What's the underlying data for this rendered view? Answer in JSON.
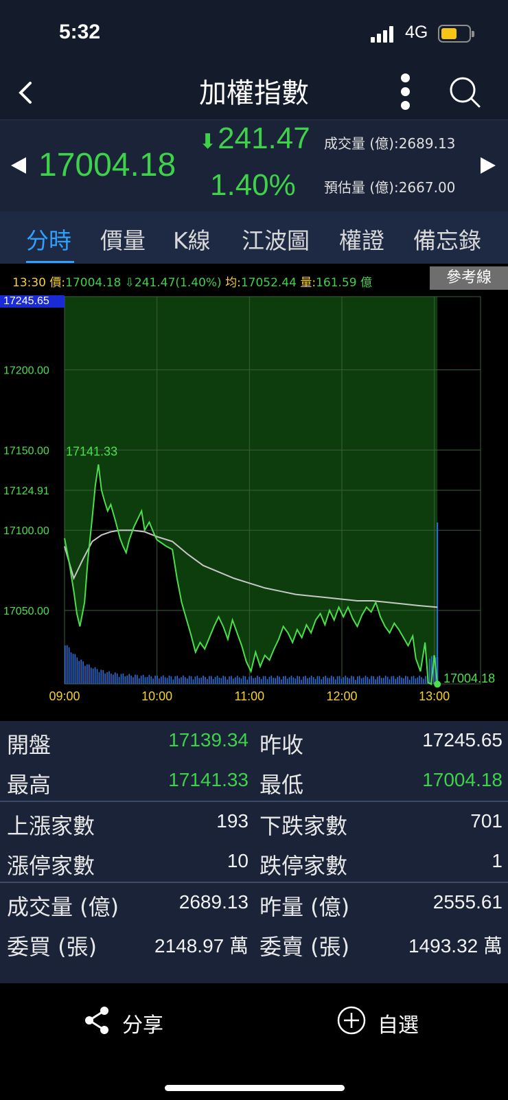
{
  "status": {
    "time": "5:32",
    "network": "4G"
  },
  "nav": {
    "title": "加權指數"
  },
  "quote": {
    "price": "17004.18",
    "change": "241.47",
    "change_pct": "1.40%",
    "volume_label": "成交量 (億):",
    "volume_value": "2689.13",
    "est_label": "預估量 (億):",
    "est_value": "2667.00"
  },
  "tabs": [
    "分時",
    "價量",
    "K線",
    "江波圖",
    "權證",
    "備忘錄"
  ],
  "info": {
    "time": "13:30",
    "price_label": "價:",
    "price": "17004.18",
    "change": "⇩241.47(1.40%)",
    "avg_label": "均:",
    "avg": "17052.44",
    "vol_label": "量:",
    "vol": "161.59 億",
    "ref_button": "參考線"
  },
  "chart_data": {
    "type": "line",
    "x_ticks": [
      "09:00",
      "10:00",
      "11:00",
      "12:00",
      "13:00"
    ],
    "y_labels": [
      "17245.65",
      "17200.00",
      "17150.00",
      "17124.91",
      "17100.00",
      "17050.00"
    ],
    "ylim": [
      17004.18,
      17245.65
    ],
    "high_label": "17141.33",
    "last_label": "17004.18",
    "colors": {
      "price": "#4be04b",
      "avg": "#c8c8c8",
      "fill": "#0d3d0d",
      "volume": "#2f6fd8",
      "grid": "#3c5e3c"
    },
    "series": [
      {
        "values": [
          [
            0,
            17095
          ],
          [
            3,
            17080
          ],
          [
            6,
            17062
          ],
          [
            8,
            17048
          ],
          [
            10,
            17040
          ],
          [
            13,
            17055
          ],
          [
            15,
            17080
          ],
          [
            18,
            17108
          ],
          [
            20,
            17128
          ],
          [
            22,
            17141
          ],
          [
            24,
            17125
          ],
          [
            26,
            17118
          ],
          [
            28,
            17112
          ],
          [
            30,
            17116
          ],
          [
            33,
            17106
          ],
          [
            36,
            17095
          ],
          [
            38,
            17090
          ],
          [
            40,
            17086
          ],
          [
            42,
            17094
          ],
          [
            45,
            17102
          ],
          [
            48,
            17108
          ],
          [
            50,
            17112
          ],
          [
            52,
            17100
          ],
          [
            55,
            17105
          ],
          [
            58,
            17098
          ],
          [
            60,
            17094
          ],
          [
            63,
            17092
          ],
          [
            66,
            17090
          ],
          [
            70,
            17088
          ],
          [
            73,
            17070
          ],
          [
            76,
            17055
          ],
          [
            79,
            17045
          ],
          [
            82,
            17035
          ],
          [
            85,
            17024
          ],
          [
            88,
            17030
          ],
          [
            91,
            17026
          ],
          [
            94,
            17033
          ],
          [
            97,
            17040
          ],
          [
            100,
            17046
          ],
          [
            103,
            17040
          ],
          [
            106,
            17032
          ],
          [
            109,
            17044
          ],
          [
            112,
            17036
          ],
          [
            115,
            17028
          ],
          [
            118,
            17018
          ],
          [
            121,
            17012
          ],
          [
            124,
            17024
          ],
          [
            127,
            17015
          ],
          [
            130,
            17022
          ],
          [
            133,
            17019
          ],
          [
            136,
            17026
          ],
          [
            139,
            17032
          ],
          [
            142,
            17040
          ],
          [
            145,
            17036
          ],
          [
            148,
            17030
          ],
          [
            151,
            17038
          ],
          [
            154,
            17033
          ],
          [
            157,
            17041
          ],
          [
            160,
            17036
          ],
          [
            163,
            17044
          ],
          [
            166,
            17048
          ],
          [
            169,
            17041
          ],
          [
            172,
            17050
          ],
          [
            175,
            17044
          ],
          [
            178,
            17052
          ],
          [
            181,
            17046
          ],
          [
            184,
            17052
          ],
          [
            187,
            17045
          ],
          [
            190,
            17040
          ],
          [
            193,
            17047
          ],
          [
            196,
            17052
          ],
          [
            199,
            17049
          ],
          [
            202,
            17055
          ],
          [
            205,
            17046
          ],
          [
            208,
            17040
          ],
          [
            211,
            17036
          ],
          [
            214,
            17042
          ],
          [
            217,
            17038
          ],
          [
            220,
            17033
          ],
          [
            223,
            17028
          ],
          [
            226,
            17034
          ],
          [
            228,
            17020
          ],
          [
            231,
            17012
          ],
          [
            234,
            17030
          ],
          [
            236,
            17005
          ],
          [
            238,
            17004
          ],
          [
            240,
            17022
          ],
          [
            242,
            17004
          ]
        ]
      },
      {
        "values": [
          [
            0,
            17090
          ],
          [
            6,
            17070
          ],
          [
            12,
            17082
          ],
          [
            18,
            17093
          ],
          [
            24,
            17097
          ],
          [
            30,
            17099
          ],
          [
            36,
            17100
          ],
          [
            44,
            17100
          ],
          [
            52,
            17099
          ],
          [
            60,
            17096
          ],
          [
            70,
            17093
          ],
          [
            80,
            17085
          ],
          [
            90,
            17078
          ],
          [
            100,
            17074
          ],
          [
            110,
            17070
          ],
          [
            120,
            17067
          ],
          [
            130,
            17064
          ],
          [
            140,
            17062
          ],
          [
            150,
            17060
          ],
          [
            160,
            17059
          ],
          [
            170,
            17058
          ],
          [
            180,
            17057
          ],
          [
            190,
            17056
          ],
          [
            200,
            17056
          ],
          [
            210,
            17055
          ],
          [
            220,
            17054
          ],
          [
            230,
            17053
          ],
          [
            242,
            17052
          ]
        ]
      }
    ]
  },
  "stats": {
    "open_label": "開盤",
    "open": "17139.34",
    "prev_label": "昨收",
    "prev": "17245.65",
    "high_label": "最高",
    "high": "17141.33",
    "low_label": "最低",
    "low": "17004.18",
    "up_label": "上漲家數",
    "up": "193",
    "down_label": "下跌家數",
    "down": "701",
    "limit_up_label": "漲停家數",
    "limit_up": "10",
    "limit_down_label": "跌停家數",
    "limit_down": "1",
    "vol_label": "成交量 (億)",
    "vol": "2689.13",
    "yvol_label": "昨量 (億)",
    "yvol": "2555.61",
    "bid_label": "委買 (張)",
    "bid": "2148.97 萬",
    "ask_label": "委賣 (張)",
    "ask": "1493.32 萬"
  },
  "bottom": {
    "share": "分享",
    "fav": "自選"
  }
}
